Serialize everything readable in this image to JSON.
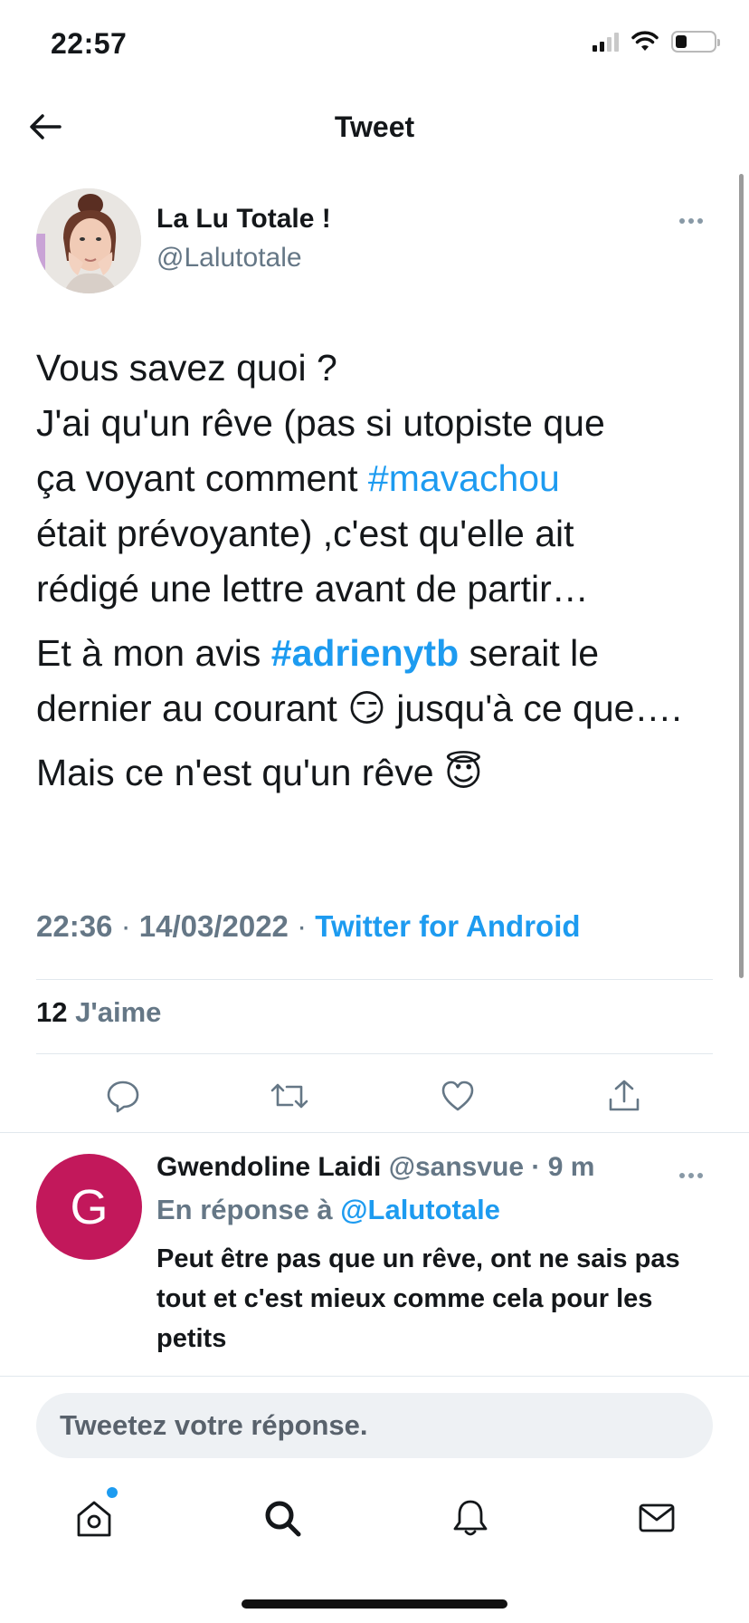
{
  "status_bar": {
    "time": "22:57"
  },
  "header": {
    "title": "Tweet"
  },
  "tweet": {
    "author_name": "La Lu Totale !",
    "author_handle": "@Lalutotale",
    "line1": "Vous savez quoi ?",
    "line2": "J'ai qu'un rêve (pas si utopiste que",
    "line3_pre": "ça voyant comment ",
    "line3_tag": "#mavachou",
    "line4": "était prévoyante) ,c'est qu'elle ait",
    "line5": "rédigé une lettre avant de partir…",
    "p2_pre": "Et à mon avis ",
    "p2_tag": "#adrienytb",
    "p2_mid": " serait le dernier au courant ",
    "p2_emoji": "😏",
    "p2_post": " jusqu'à ce que….",
    "p3_text": "Mais ce n'est qu'un rêve ",
    "p3_emoji": "😇",
    "time": "22:36",
    "date": "14/03/2022",
    "separator": " · ",
    "source": "Twitter for Android",
    "likes_count": "12",
    "likes_label": "J'aime"
  },
  "reply": {
    "avatar_letter": "G",
    "avatar_color": "#c2185b",
    "name": "Gwendoline Laidi",
    "handle": "@sansvue",
    "time": "9 m",
    "in_reply_prefix": "En réponse à ",
    "in_reply_handle": "@Lalutotale",
    "text": "Peut être pas que un rêve, ont ne sais pas tout  et c'est mieux comme cela pour les petits"
  },
  "composer": {
    "placeholder": "Tweetez votre réponse."
  },
  "icons": {
    "back": "arrow-left-icon",
    "more": "more-horizontal-icon",
    "reply": "reply-icon",
    "retweet": "retweet-icon",
    "like": "heart-icon",
    "share": "share-icon",
    "home": "home-icon",
    "search": "search-icon",
    "notifications": "bell-icon",
    "messages": "envelope-icon"
  },
  "colors": {
    "accent": "#1d9bf0",
    "muted": "#657786",
    "text": "#14171a"
  }
}
